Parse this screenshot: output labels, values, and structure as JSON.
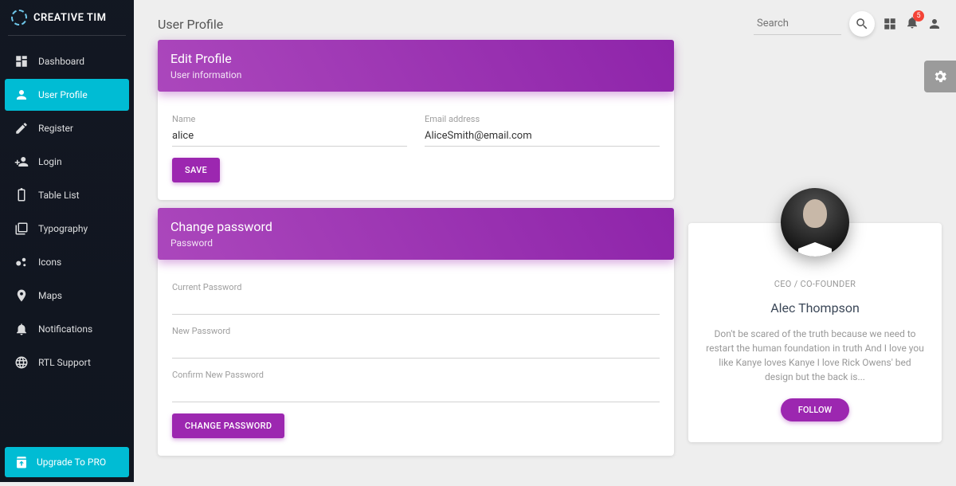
{
  "brand": "CREATIVE TIM",
  "sidebar": {
    "items": [
      {
        "label": "Dashboard"
      },
      {
        "label": "User Profile"
      },
      {
        "label": "Register"
      },
      {
        "label": "Login"
      },
      {
        "label": "Table List"
      },
      {
        "label": "Typography"
      },
      {
        "label": "Icons"
      },
      {
        "label": "Maps"
      },
      {
        "label": "Notifications"
      },
      {
        "label": "RTL Support"
      }
    ],
    "upgrade": "Upgrade To PRO"
  },
  "page_title": "User Profile",
  "search_placeholder": "Search",
  "notif_count": "5",
  "edit_card": {
    "title": "Edit Profile",
    "subtitle": "User information",
    "name_label": "Name",
    "name_value": "alice",
    "email_label": "Email address",
    "email_value": "AliceSmith@email.com",
    "save": "SAVE"
  },
  "pw_card": {
    "title": "Change password",
    "subtitle": "Password",
    "current": "Current Password",
    "new": "New Password",
    "confirm": "Confirm New Password",
    "button": "CHANGE PASSWORD"
  },
  "profile": {
    "role": "CEO / CO-FOUNDER",
    "name": "Alec Thompson",
    "bio": "Don't be scared of the truth because we need to restart the human foundation in truth And I love you like Kanye loves Kanye I love Rick Owens' bed design but the back is...",
    "follow": "FOLLOW"
  }
}
